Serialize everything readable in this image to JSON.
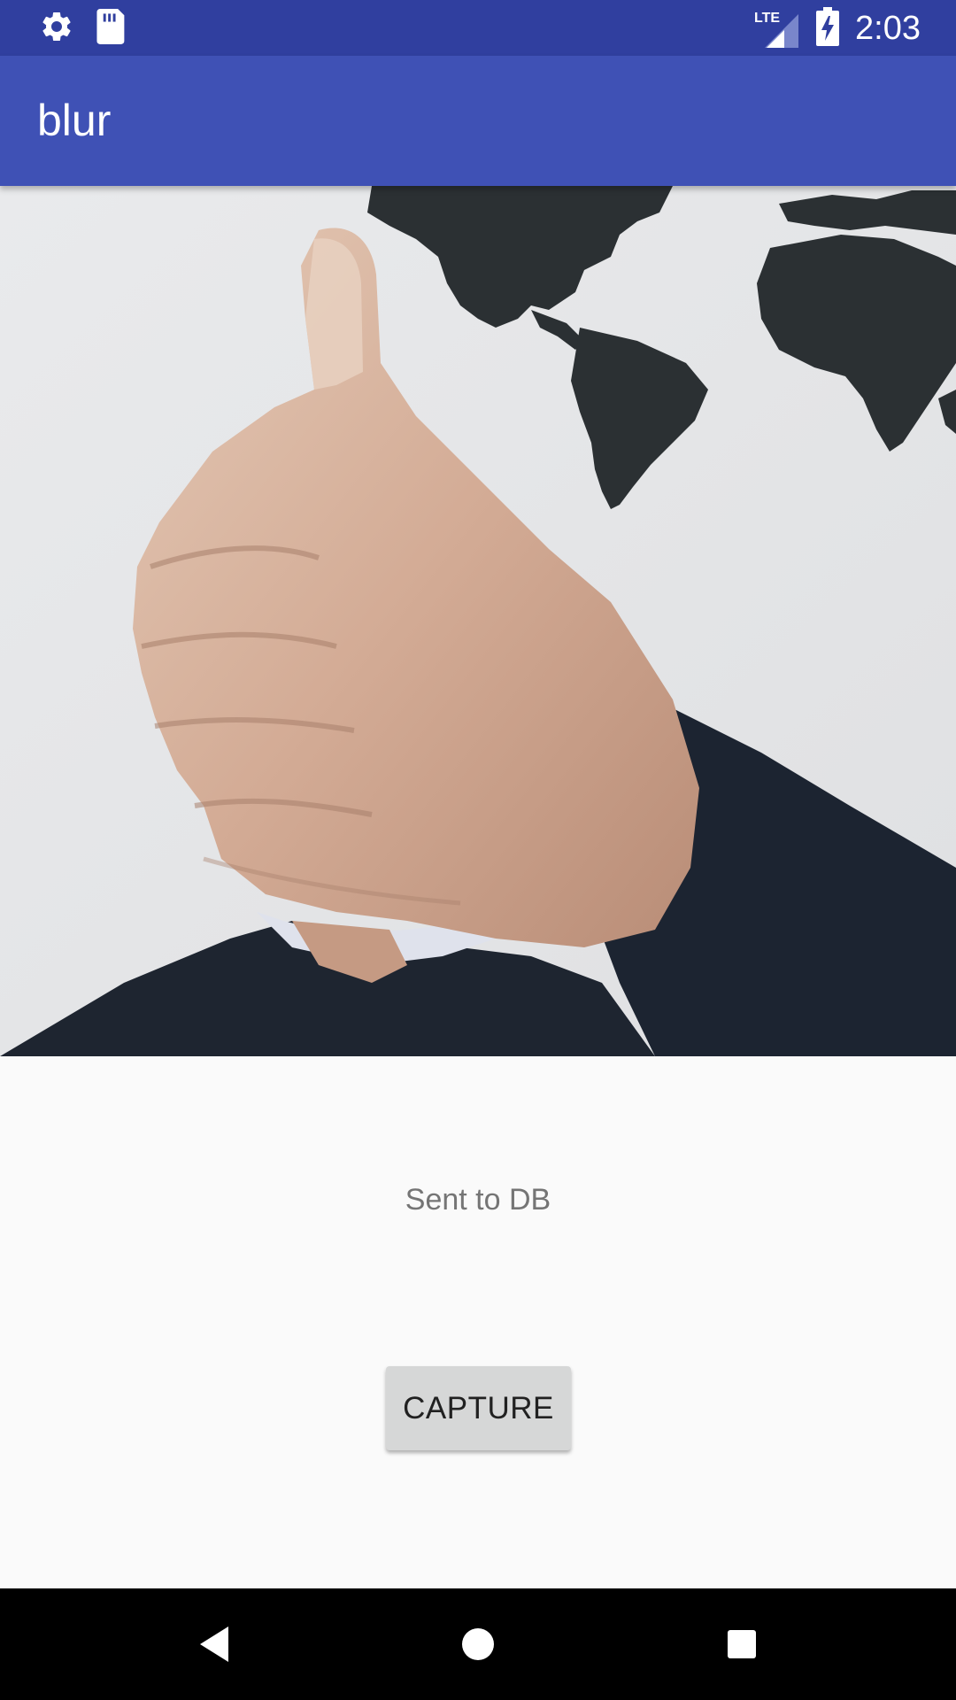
{
  "status_bar": {
    "time": "2:03",
    "network": "LTE",
    "icons": [
      "gear-icon",
      "sd-card-icon",
      "lte-signal-icon",
      "battery-charging-icon"
    ]
  },
  "app_bar": {
    "title": "blur"
  },
  "camera": {
    "icon": "camera-preview"
  },
  "main": {
    "status_message": "Sent to DB",
    "capture_label": "CAPTURE"
  },
  "nav_bar": {
    "icons": [
      "back-icon",
      "home-icon",
      "recents-icon"
    ]
  },
  "colors": {
    "status_bar": "#303f9f",
    "app_bar": "#3f51b5",
    "background": "#fafafa",
    "button": "#d6d7d7",
    "nav_bar": "#000000"
  }
}
